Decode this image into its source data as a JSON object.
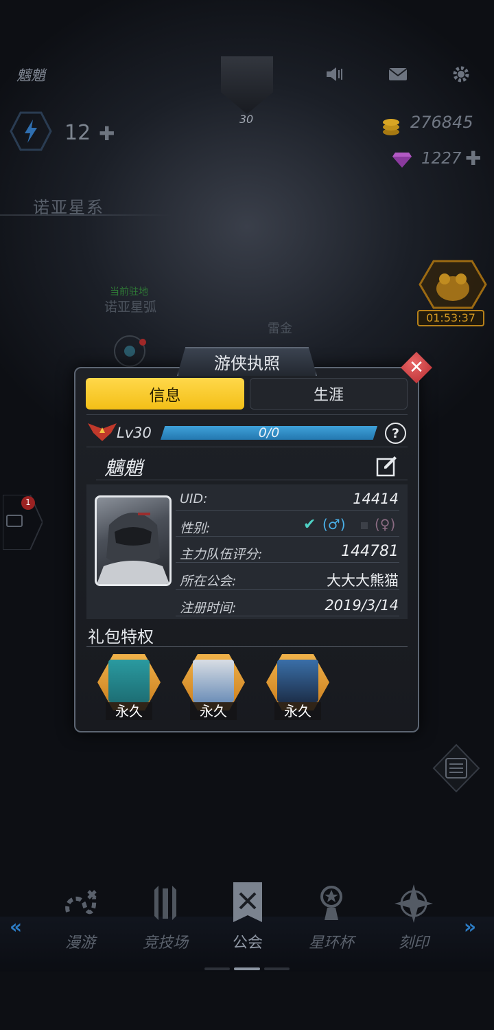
{
  "hud": {
    "player_name": "魑魈",
    "player_level": "30",
    "energy": "12",
    "gold": "276845",
    "gems": "1227",
    "system_name": "诺亚星系",
    "station_label": "当前驻地",
    "station_name": "诺亚星弧",
    "planet_name": "雷金",
    "event_timer": "01:53:37",
    "chat_badge": "1"
  },
  "dialog": {
    "title": "游侠执照",
    "tabs": [
      {
        "label": "信息",
        "active": true
      },
      {
        "label": "生涯",
        "active": false
      }
    ],
    "level_text": "Lv30",
    "xp_text": "0/0",
    "xp_fraction": 1.0,
    "help_label": "?",
    "nickname": "魑魈",
    "rows": [
      {
        "label": "UID:",
        "value": "14414"
      },
      {
        "label": "性别:",
        "value": ""
      },
      {
        "label": "主力队伍评分:",
        "value": "144781"
      },
      {
        "label": "所在公会:",
        "value": "大大大熊猫"
      },
      {
        "label": "注册时间:",
        "value": "2019/3/14"
      }
    ],
    "gender": {
      "male_label": "(♂)",
      "female_label": "(♀)",
      "selected": "male"
    },
    "perk_title": "礼包特权",
    "perks": [
      {
        "tag": "永久"
      },
      {
        "tag": "永久"
      },
      {
        "tag": "永久"
      }
    ]
  },
  "nav": {
    "items": [
      {
        "label": "漫游",
        "icon": "roam-icon"
      },
      {
        "label": "竞技场",
        "icon": "arena-icon"
      },
      {
        "label": "公会",
        "icon": "guild-banner-icon",
        "active": true
      },
      {
        "label": "星环杯",
        "icon": "trophy-icon"
      },
      {
        "label": "刻印",
        "icon": "compass-star-icon"
      }
    ]
  },
  "colors": {
    "accent_yellow": "#f3bf17",
    "xp_blue": "#2f8fca",
    "close_red": "#c9363b",
    "gold": "#d59a22"
  }
}
